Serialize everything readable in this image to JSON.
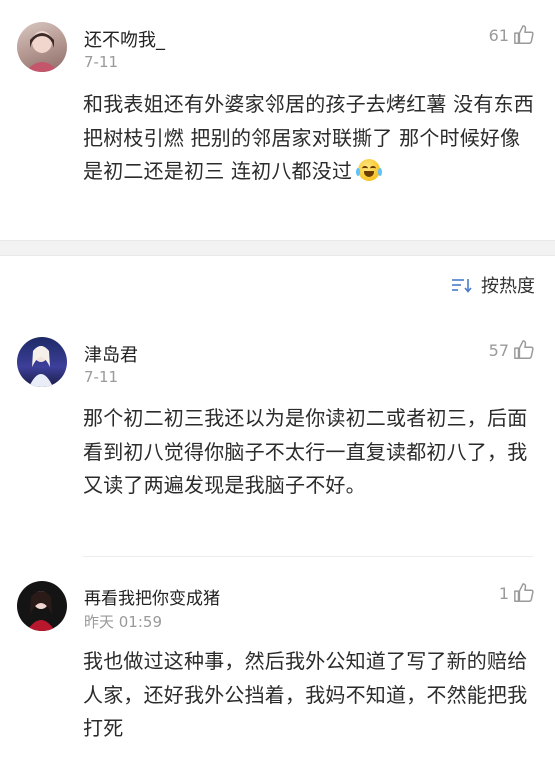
{
  "sort": {
    "label": "按热度",
    "icon": "sort-icon"
  },
  "comments": [
    {
      "username": "还不吻我_",
      "date": "7-11",
      "likes": "61",
      "text": "和我表姐还有外婆家邻居的孩子去烤红薯 没有东西把树枝引燃 把别的邻居家对联撕了 那个时候好像是初二还是初三 连初八都没过",
      "emoji": "laughing-crying-emoji"
    },
    {
      "username": "津岛君",
      "date": "7-11",
      "likes": "57",
      "text": "那个初二初三我还以为是你读初二或者初三，后面看到初八觉得你脑子不太行一直复读都初八了，我又读了两遍发现是我脑子不好。"
    },
    {
      "username": "再看我把你变成猪",
      "date": "昨天 01:59",
      "likes": "1",
      "text": "我也做过这种事，然后我外公知道了写了新的赔给人家，还好我外公挡着，我妈不知道，不然能把我打死"
    }
  ],
  "colors": {
    "separator": "#f2f2f2",
    "meta_gray": "#9a9a9a",
    "text": "#2b2b2b"
  }
}
